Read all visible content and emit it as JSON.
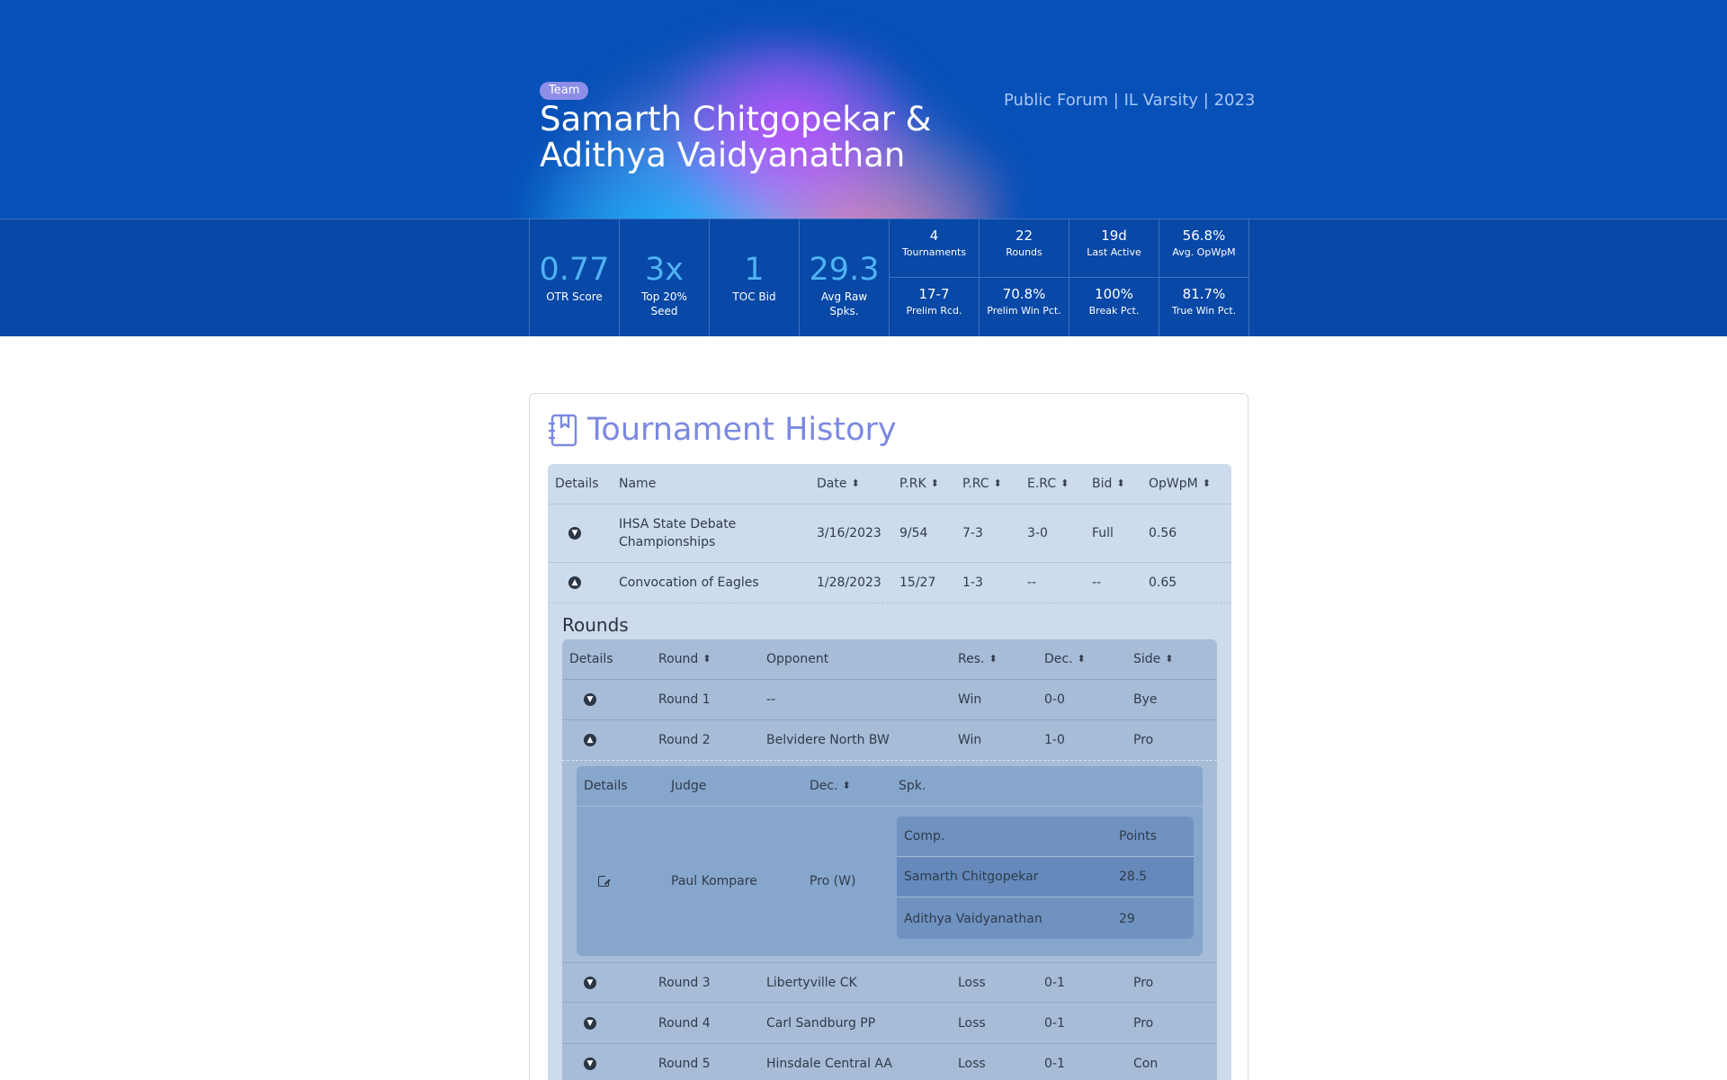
{
  "hero": {
    "badge": "Team",
    "name": "Samarth Chitgopekar & Adithya Vaidyanathan",
    "meta": "Public Forum | IL Varsity | 2023"
  },
  "stats": {
    "big": [
      {
        "value": "0.77",
        "label": "OTR Score"
      },
      {
        "value": "3x",
        "label": "Top 20% Seed"
      },
      {
        "value": "1",
        "label": "TOC Bid"
      },
      {
        "value": "29.3",
        "label": "Avg Raw Spks."
      }
    ],
    "small": [
      {
        "value": "4",
        "label": "Tournaments"
      },
      {
        "value": "22",
        "label": "Rounds"
      },
      {
        "value": "19d",
        "label": "Last Active"
      },
      {
        "value": "56.8%",
        "label": "Avg. OpWpM"
      },
      {
        "value": "17-7",
        "label": "Prelim Rcd."
      },
      {
        "value": "70.8%",
        "label": "Prelim Win Pct."
      },
      {
        "value": "100%",
        "label": "Break Pct."
      },
      {
        "value": "81.7%",
        "label": "True Win Pct."
      }
    ]
  },
  "history": {
    "title": "Tournament History",
    "columns": {
      "details": "Details",
      "name": "Name",
      "date": "Date",
      "prk": "P.RK",
      "prc": "P.RC",
      "erc": "E.RC",
      "bid": "Bid",
      "opwpm": "OpWpM"
    },
    "rows": [
      {
        "name": "IHSA State Debate Championships",
        "date": "3/16/2023",
        "prk": "9/54",
        "prc": "7-3",
        "erc": "3-0",
        "bid": "Full",
        "opwpm": "0.56"
      },
      {
        "name": "Convocation of Eagles",
        "date": "1/28/2023",
        "prk": "15/27",
        "prc": "1-3",
        "erc": "--",
        "bid": "--",
        "opwpm": "0.65"
      }
    ]
  },
  "rounds": {
    "title": "Rounds",
    "columns": {
      "details": "Details",
      "round": "Round",
      "opponent": "Opponent",
      "res": "Res.",
      "dec": "Dec.",
      "side": "Side"
    },
    "rows": [
      {
        "round": "Round 1",
        "opponent": "--",
        "res": "Win",
        "dec": "0-0",
        "side": "Bye"
      },
      {
        "round": "Round 2",
        "opponent": "Belvidere North BW",
        "res": "Win",
        "dec": "1-0",
        "side": "Pro"
      },
      {
        "round": "Round 3",
        "opponent": "Libertyville CK",
        "res": "Loss",
        "dec": "0-1",
        "side": "Pro"
      },
      {
        "round": "Round 4",
        "opponent": "Carl Sandburg PP",
        "res": "Loss",
        "dec": "0-1",
        "side": "Pro"
      },
      {
        "round": "Round 5",
        "opponent": "Hinsdale Central AA",
        "res": "Loss",
        "dec": "0-1",
        "side": "Con"
      }
    ]
  },
  "judges": {
    "columns": {
      "details": "Details",
      "judge": "Judge",
      "dec": "Dec.",
      "spk": "Spk."
    },
    "row": {
      "judge": "Paul Kompare",
      "dec": "Pro (W)"
    },
    "speaks": {
      "columns": {
        "comp": "Comp.",
        "points": "Points"
      },
      "rows": [
        {
          "comp": "Samarth Chitgopekar",
          "points": "28.5"
        },
        {
          "comp": "Adithya Vaidyanathan",
          "points": "29"
        }
      ]
    }
  },
  "icons": {
    "expand": "chevron-down-icon",
    "collapse": "chevron-up-icon",
    "sort": "sort-icon",
    "external": "external-link-icon",
    "history": "notebook-icon"
  },
  "colors": {
    "hero_bg": "#0750b8",
    "stats_bg": "#0848a6",
    "stat_accent": "#4fb2f4",
    "title_accent": "#7b89e2",
    "outer_table": "#cddbec",
    "rounds_table": "#a7bcd7",
    "judge_table": "#87a6cc",
    "speaks_table": "#6f92c1"
  }
}
